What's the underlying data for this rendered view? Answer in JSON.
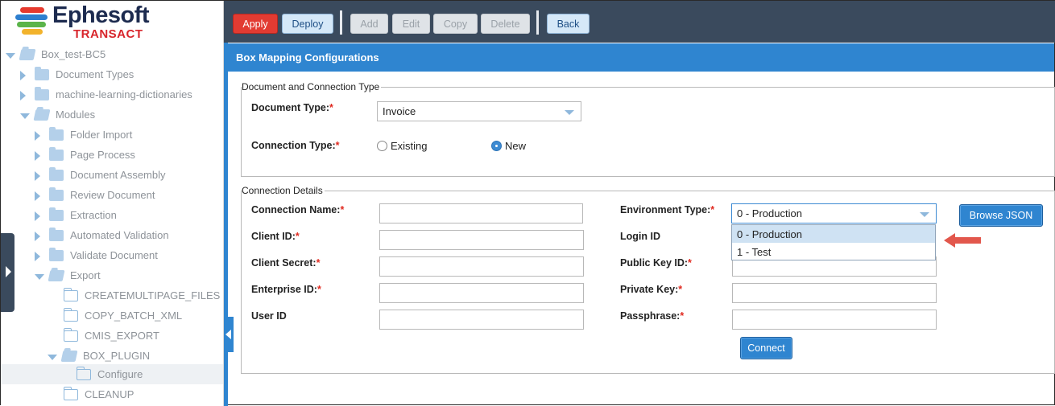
{
  "brand": {
    "title": "Ephesoft",
    "subtitle": "TRANSACT"
  },
  "toolbar": {
    "apply": "Apply",
    "deploy": "Deploy",
    "add": "Add",
    "edit": "Edit",
    "copy": "Copy",
    "delete": "Delete",
    "back": "Back"
  },
  "tree": {
    "items": [
      {
        "label": "Box_test-BC5"
      },
      {
        "label": "Document Types"
      },
      {
        "label": "machine-learning-dictionaries"
      },
      {
        "label": "Modules"
      },
      {
        "label": "Folder Import"
      },
      {
        "label": "Page Process"
      },
      {
        "label": "Document Assembly"
      },
      {
        "label": "Review Document"
      },
      {
        "label": "Extraction"
      },
      {
        "label": "Automated Validation"
      },
      {
        "label": "Validate Document"
      },
      {
        "label": "Export"
      },
      {
        "label": "CREATEMULTIPAGE_FILES"
      },
      {
        "label": "COPY_BATCH_XML"
      },
      {
        "label": "CMIS_EXPORT"
      },
      {
        "label": "BOX_PLUGIN"
      },
      {
        "label": "Configure"
      },
      {
        "label": "CLEANUP"
      }
    ]
  },
  "panel": {
    "title": "Box Mapping Configurations"
  },
  "doc_conn": {
    "legend": "Document and Connection Type",
    "doc_type_label": "Document Type:",
    "doc_type_value": "Invoice",
    "conn_type_label": "Connection Type:",
    "radio_existing": "Existing",
    "radio_new": "New",
    "selected": "New"
  },
  "conn_details": {
    "legend": "Connection Details",
    "connection_name": "Connection Name:",
    "client_id": "Client ID:",
    "client_secret": "Client Secret:",
    "enterprise_id": "Enterprise ID:",
    "user_id": "User ID",
    "environment_type": "Environment Type:",
    "login_id": "Login ID",
    "public_key_id": "Public Key ID:",
    "private_key": "Private Key:",
    "passphrase": "Passphrase:",
    "environment_value": "0 - Production",
    "environment_options": [
      "0 - Production",
      "1 - Test"
    ],
    "browse_json": "Browse JSON",
    "connect": "Connect"
  },
  "required_mark": "*",
  "colors": {
    "accent": "#2f85d0",
    "apply": "#e23b32",
    "header": "#3a4a5d",
    "pointer": "#e2574c"
  }
}
